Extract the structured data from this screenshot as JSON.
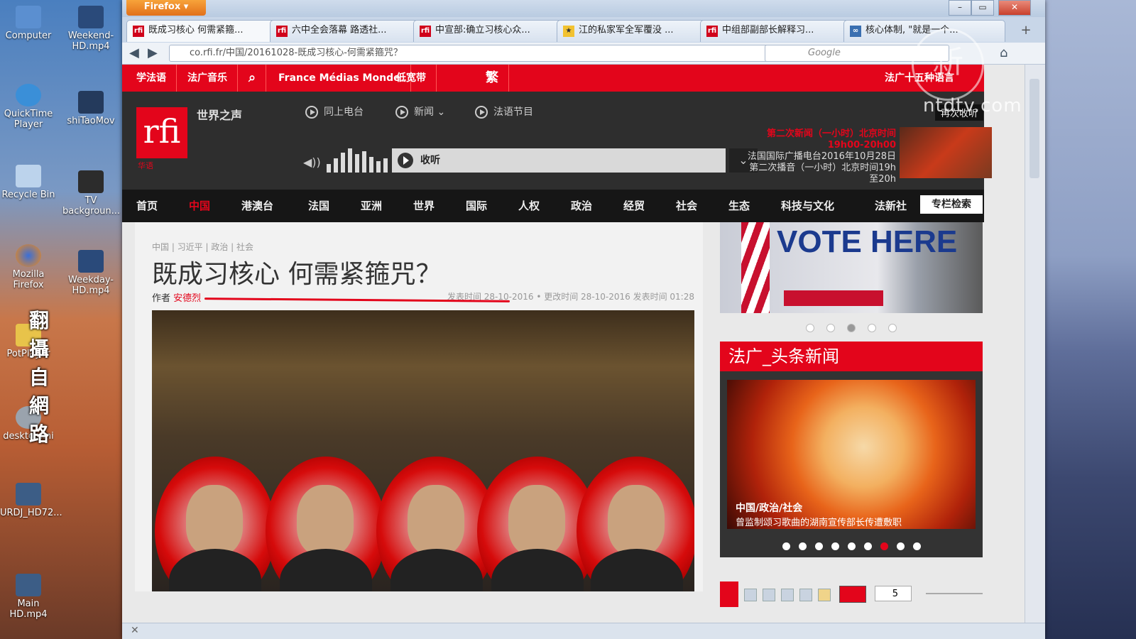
{
  "desktop": {
    "icons": [
      {
        "name": "Computer",
        "label": "Computer"
      },
      {
        "name": "Weekend",
        "label": "Weekend-HD.mp4"
      },
      {
        "name": "QuickTime",
        "label": "QuickTime Player"
      },
      {
        "name": "shiTaoMov",
        "label": "shiTaoMov"
      },
      {
        "name": "RecycleBin",
        "label": "Recycle Bin"
      },
      {
        "name": "TVbackground",
        "label": "TV backgroun..."
      },
      {
        "name": "MozillaFirefox",
        "label": "Mozilla Firefox"
      },
      {
        "name": "Weekday",
        "label": "Weekday-HD.mp4"
      },
      {
        "name": "PotPlayer",
        "label": "PotPlayer"
      },
      {
        "name": "desktopini",
        "label": "desktop.ini"
      },
      {
        "name": "URDJ",
        "label": "URDJ_HD72..."
      },
      {
        "name": "MainHD",
        "label": "Main HD.mp4"
      }
    ]
  },
  "browser": {
    "app_button": "Firefox ▾",
    "tabs": [
      {
        "label": "既成习核心 何需紧箍...",
        "favicon": "rfi"
      },
      {
        "label": "六中全会落幕 路透社...",
        "favicon": "rfi"
      },
      {
        "label": "中宣部:确立习核心众...",
        "favicon": "rfi"
      },
      {
        "label": "江的私家军全军覆没 ...",
        "favicon": "star"
      },
      {
        "label": "中组部副部长解释习...",
        "favicon": "rfi"
      },
      {
        "label": "核心体制, \"就是一个...",
        "favicon": "link"
      }
    ],
    "url": "co.rfi.fr/中国/20161028-既成习核心-何需紧箍咒？",
    "search_placeholder": "Google",
    "status_text": "✕"
  },
  "site": {
    "topbar": [
      "学法语",
      "法广音乐",
      "France Médias Monde",
      "低宽带",
      "繁",
      "法广十五种语言"
    ],
    "logo_text": "rfi",
    "logo_sub": "华语",
    "slogan": "世界之声",
    "header_nav": [
      "同上电台",
      "新闻 ⌄",
      "法语节目"
    ],
    "player_label": "收听",
    "broadcast_title": "第二次新闻（一小时）北京时间19h00-20h00",
    "broadcast_desc": "法国国际广播电台2016年10月28日第二次播音（一小时）北京时间19h至20h",
    "listen_tag": "再次收听",
    "main_nav": [
      "首页",
      "中国",
      "港澳台",
      "法国",
      "亚洲",
      "世界",
      "国际",
      "人权",
      "政治",
      "经贸",
      "社会",
      "生态",
      "科技与文化",
      "法新社"
    ],
    "main_nav_active": 1,
    "column_search": "专栏检索"
  },
  "article": {
    "breadcrumbs": "中国 | 习近平 | 政治 | 社会",
    "headline": "既成习核心 何需紧箍咒？",
    "author_label": "作者",
    "author": "安德烈",
    "pub_time": "发表时间 28-10-2016 • 更改时间 28-10-2016 发表时间 01:28",
    "overlay_text": "翻攝自網路"
  },
  "sidebar": {
    "vote_text": "VOTE HERE",
    "carousel_dots": 5,
    "carousel_active": 2,
    "headnews_title": "法广_头条新闻",
    "headnews_category": "中国/政治/社会",
    "headnews_caption": "曾监制颂习歌曲的湖南宣传部长传遭敷职",
    "headnews_dots": 9,
    "headnews_active": 6,
    "brush_size": "5"
  },
  "watermark": {
    "logo_char": "新",
    "site": "ntdtv.com"
  },
  "colors": {
    "rfi_red": "#e3051b",
    "header_dark": "#2e2e2e",
    "nav_black": "#161616"
  }
}
